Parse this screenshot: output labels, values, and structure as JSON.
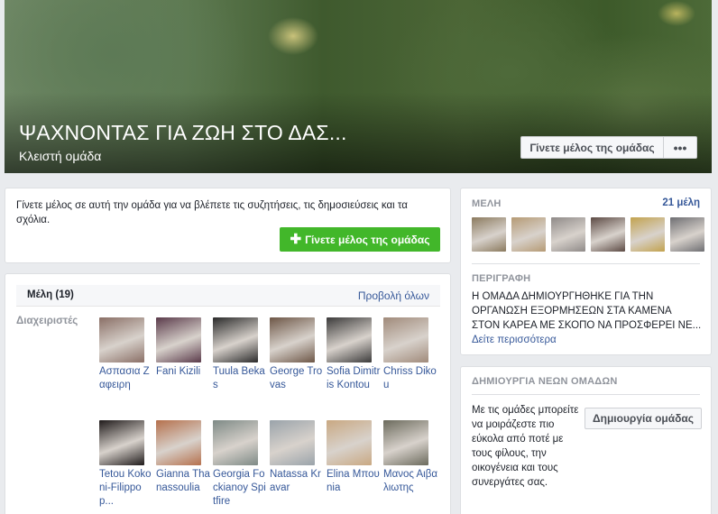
{
  "cover": {
    "title": "ΨΑΧΝΟΝΤΑΣ ΓΙΑ ΖΩΗ ΣΤΟ ΔΑΣ...",
    "subtitle": "Κλειστή ομάδα",
    "join_label": "Γίνετε μέλος της ομάδας",
    "more_label": "•••"
  },
  "join_card": {
    "text": "Γίνετε μέλος σε αυτή την ομάδα για να βλέπετε τις συζητήσεις, τις δημοσιεύσεις και τα σχόλια.",
    "button_label": "Γίνετε μέλος της ομάδας",
    "button_icon": "plus-icon"
  },
  "members_card": {
    "title": "Μέλη (19)",
    "view_all": "Προβολή όλων",
    "admins_label": "Διαχειριστές",
    "members": [
      {
        "name": "Ασπασια Ζαφειρη",
        "color": "#8a6f66"
      },
      {
        "name": "Fani Kizili",
        "color": "#5a3a4a"
      },
      {
        "name": "Tuula Bekas",
        "color": "#2a2a2a"
      },
      {
        "name": "George Trovas",
        "color": "#6d5646"
      },
      {
        "name": "Sofia Dimitris Kontou",
        "color": "#3b3a3a"
      },
      {
        "name": "Chriss Dikou",
        "color": "#a08a7a"
      },
      {
        "name": "Tetou Kokoni-Filippop...",
        "color": "#1f1a1a"
      },
      {
        "name": "Gianna Thanassoulia",
        "color": "#b5704c"
      },
      {
        "name": "Georgia Fockianoy Spitfire",
        "color": "#7e8a86"
      },
      {
        "name": "Natassa Kravar",
        "color": "#9aa3aa"
      },
      {
        "name": "Elina Μπουnia",
        "color": "#c9a882"
      },
      {
        "name": "Μανος Αιβαλιωτης",
        "color": "#6b6a5c"
      }
    ]
  },
  "members_panel": {
    "label": "ΜΕΛΗ",
    "count": "21 μέλη",
    "thumb_colors": [
      "#8b7a5e",
      "#b59a74",
      "#8f8a88",
      "#5c4a44",
      "#c2a24e",
      "#6e6e72"
    ]
  },
  "description_panel": {
    "label": "ΠΕΡΙΓΡΑΦΗ",
    "text": "Η ΟΜΑΔΑ ΔΗΜΙΟΥΡΓΗΘΗΚΕ ΓΙΑ ΤΗΝ ΟΡΓΑΝΩΣΗ ΕΞΟΡΜΗΣΕΩΝ ΣΤΑ ΚΑΜΕΝΑ ΣΤΟΝ ΚΑΡΕΑ ΜΕ ΣΚΟΠΟ ΝΑ ΠΡΟΣΦΕΡΕΙ ΝΕ...",
    "more_link": "Δείτε περισσότερα"
  },
  "create_panel": {
    "label": "ΔΗΜΙΟΥΡΓΙΑ ΝΕΩΝ ΟΜΑΔΩΝ",
    "text": "Με τις ομάδες μπορείτε να μοιράζεστε πιο εύκολα από ποτέ με τους φίλους, την οικογένεια και τους συνεργάτες σας.",
    "button_label": "Δημιουργία ομάδας"
  }
}
